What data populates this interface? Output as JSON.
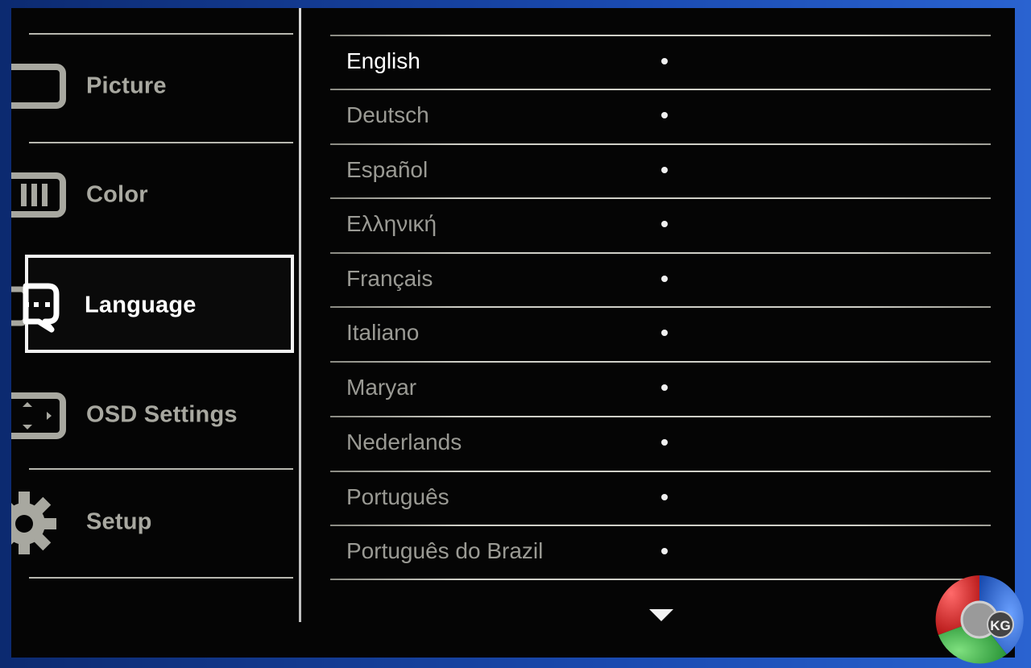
{
  "sidebar": {
    "items": [
      {
        "label": "Picture",
        "icon": "picture-icon",
        "active": false
      },
      {
        "label": "Color",
        "icon": "color-icon",
        "active": false
      },
      {
        "label": "Language",
        "icon": "language-icon",
        "active": true
      },
      {
        "label": "OSD Settings",
        "icon": "osd-settings-icon",
        "active": false
      },
      {
        "label": "Setup",
        "icon": "gear-icon",
        "active": false
      }
    ]
  },
  "languages": {
    "selected": "English",
    "items": [
      "English",
      "Deutsch",
      "Español",
      "Ελληνική",
      "Français",
      "Italiano",
      "Maryar",
      "Nederlands",
      "Português",
      "Português do Brazil"
    ],
    "more_indicator": "chevron-down-icon"
  },
  "watermark": {
    "text": "KG",
    "colors": [
      "#d42020",
      "#2aa13a",
      "#1a5fd0"
    ]
  },
  "colors": {
    "panel": "#050505",
    "selected_text": "#ffffff",
    "unselected_text": "#9a9a94"
  }
}
